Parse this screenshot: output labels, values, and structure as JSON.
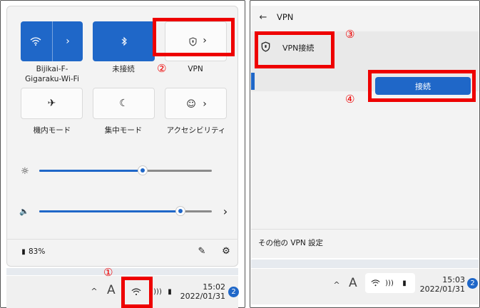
{
  "left": {
    "tiles": [
      {
        "label": "Bijikai-F-\nGigaraku-Wi-Fi",
        "label_line1": "Bijikai-F-",
        "label_line2": "Gigaraku-Wi-Fi"
      },
      {
        "label": "未接続"
      },
      {
        "label": "VPN"
      },
      {
        "label": "機内モード"
      },
      {
        "label": "集中モード"
      },
      {
        "label": "アクセシビリティ"
      }
    ],
    "brightness_level": 0.6,
    "volume_level": 0.82,
    "battery_text": "83%",
    "taskbar": {
      "time": "15:02",
      "date": "2022/01/31",
      "notification_count": "2",
      "lang": "A"
    }
  },
  "right": {
    "header_title": "VPN",
    "connection_name": "VPN接続",
    "connect_button": "接続",
    "footer_link": "その他の VPN 設定",
    "taskbar": {
      "time": "15:03",
      "date": "2022/01/31",
      "notification_count": "2",
      "lang": "A"
    }
  },
  "steps": {
    "s1": "①",
    "s2": "②",
    "s3": "③",
    "s4": "④"
  },
  "colors": {
    "accent": "#1f67c8",
    "highlight": "#ee0000",
    "panel": "#f3f3f3"
  }
}
